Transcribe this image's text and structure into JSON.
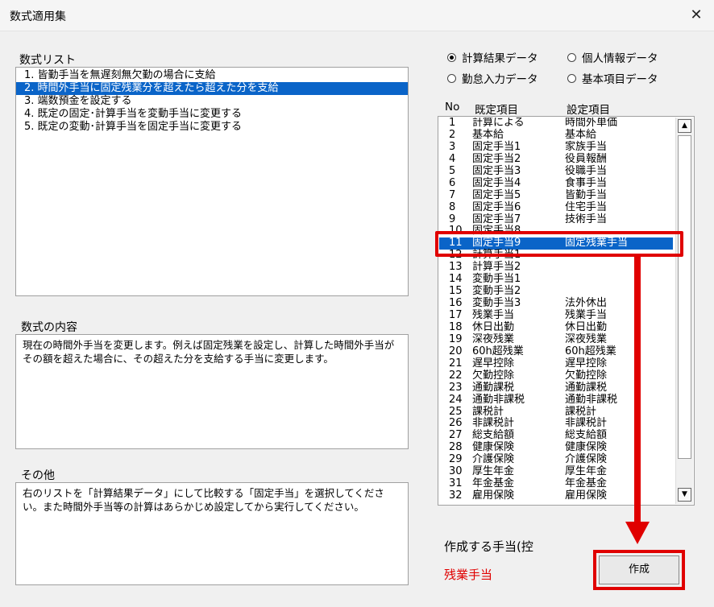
{
  "window": {
    "title": "数式適用集",
    "close_glyph": "✕"
  },
  "formula_list": {
    "label": "数式リスト",
    "items": [
      "1. 皆勤手当を無遅刻無欠勤の場合に支給",
      "2. 時間外手当に固定残業分を超えたら超えた分を支給",
      "3. 端数預金を設定する",
      "4. 既定の固定･計算手当を変動手当に変更する",
      "5. 既定の変動･計算手当を固定手当に変更する"
    ]
  },
  "content": {
    "label": "数式の内容",
    "text": "現在の時間外手当を変更します。例えば固定残業を設定し、計算した時間外手当がその額を超えた場合に、その超えた分を支給する手当に変更します。"
  },
  "other": {
    "label": "その他",
    "text": "右のリストを「計算結果データ」にして比較する「固定手当」を選択してください。また時間外手当等の計算はあらかじめ設定してから実行してください。"
  },
  "radios": {
    "r1": "計算結果データ",
    "r2": "個人情報データ",
    "r3": "勤怠入力データ",
    "r4": "基本項目データ"
  },
  "table": {
    "col_no": "No",
    "col_default": "既定項目",
    "col_setting": "設定項目",
    "rows": [
      [
        "1",
        "計算による",
        "時間外単価"
      ],
      [
        "2",
        "基本給",
        "基本給"
      ],
      [
        "3",
        "固定手当1",
        "家族手当"
      ],
      [
        "4",
        "固定手当2",
        "役員報酬"
      ],
      [
        "5",
        "固定手当3",
        "役職手当"
      ],
      [
        "6",
        "固定手当4",
        "食事手当"
      ],
      [
        "7",
        "固定手当5",
        "皆勤手当"
      ],
      [
        "8",
        "固定手当6",
        "住宅手当"
      ],
      [
        "9",
        "固定手当7",
        "技術手当"
      ],
      [
        "10",
        "固定手当8",
        ""
      ],
      [
        "11",
        "固定手当9",
        "固定残業手当"
      ],
      [
        "12",
        "計算手当1",
        ""
      ],
      [
        "13",
        "計算手当2",
        ""
      ],
      [
        "14",
        "変動手当1",
        ""
      ],
      [
        "15",
        "変動手当2",
        ""
      ],
      [
        "16",
        "変動手当3",
        "法外休出"
      ],
      [
        "17",
        "残業手当",
        "残業手当"
      ],
      [
        "18",
        "休日出勤",
        "休日出勤"
      ],
      [
        "19",
        "深夜残業",
        "深夜残業"
      ],
      [
        "20",
        "60h超残業",
        "60h超残業"
      ],
      [
        "21",
        "遅早控除",
        "遅早控除"
      ],
      [
        "22",
        "欠勤控除",
        "欠勤控除"
      ],
      [
        "23",
        "通勤課税",
        "通勤課税"
      ],
      [
        "24",
        "通勤非課税",
        "通勤非課税"
      ],
      [
        "25",
        "課税計",
        "課税計"
      ],
      [
        "26",
        "非課税計",
        "非課税計"
      ],
      [
        "27",
        "総支給額",
        "総支給額"
      ],
      [
        "28",
        "健康保険",
        "健康保険"
      ],
      [
        "29",
        "介護保険",
        "介護保険"
      ],
      [
        "30",
        "厚生年金",
        "厚生年金"
      ],
      [
        "31",
        "年金基金",
        "年金基金"
      ],
      [
        "32",
        "雇用保険",
        "雇用保険"
      ]
    ]
  },
  "target": {
    "label": "作成する手当(控",
    "value": "残業手当"
  },
  "create_button": "作成",
  "colors": {
    "selection": "#0a64c8",
    "annotation": "#e00000"
  }
}
